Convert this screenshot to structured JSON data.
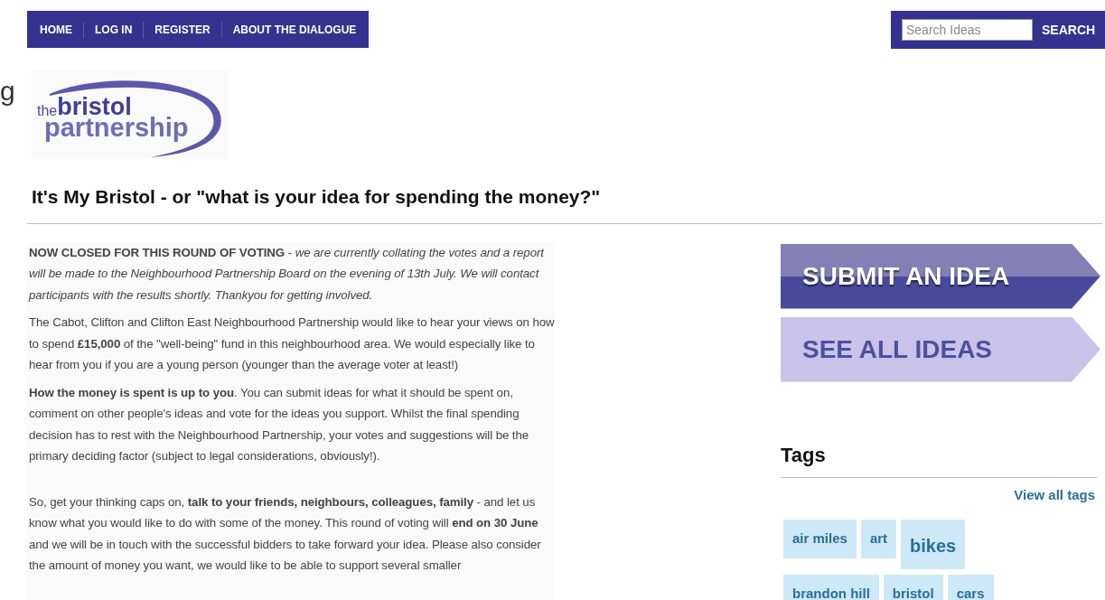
{
  "nav": {
    "items": [
      "HOME",
      "LOG IN",
      "REGISTER",
      "ABOUT THE DIALOGUE"
    ]
  },
  "search": {
    "placeholder": "Search Ideas",
    "button": "SEARCH"
  },
  "edge_text": "g",
  "logo": {
    "prefix": "the",
    "name": "bristol",
    "suffix": "partnership"
  },
  "heading": "It's My Bristol - or \"what is your idea for spending the money?\"",
  "paragraphs": [
    "**NOW CLOSED FOR THIS ROUND OF VOTING** - *we are currently collating the votes and a report will be made to the Neighbourhood Partnership Board on the evening of 13th July. We will contact participants with the results shortly. Thankyou for getting involved.*",
    "The Cabot, Clifton and Clifton East Neighbourhood Partnership would like to hear your views on how to spend **£15,000** of the \"well-being\" fund in this neighbourhood area. We would especially like to hear from you if you are a young person (younger than the average voter at least!)",
    "**How the money is spent is up to you**. You can submit ideas for what it should be spent on, comment on other people's ideas and vote for the ideas you support. Whilst the final spending decision has to rest with the Neighbourhood Partnership, your votes and suggestions will be the primary deciding factor (subject to legal considerations, obviously!).",
    "So, get your thinking caps on, **talk to your friends, neighbours, colleagues, family** - and let us know what you would like to do with some of the money. This round of voting will **end on 30 June** and we will be in touch with the successful bidders to take forward your idea. Please also consider the amount of money you want, we would like to be able to support several smaller"
  ],
  "actions": [
    {
      "label": "SUBMIT AN IDEA",
      "kind": "primary"
    },
    {
      "label": "SEE ALL IDEAS",
      "kind": "secondary"
    }
  ],
  "tags": {
    "title": "Tags",
    "view_all": "View all tags",
    "rows": [
      [
        {
          "label": "air miles",
          "kind": "normal"
        },
        {
          "label": "art",
          "kind": "normal"
        },
        {
          "label": "bikes",
          "kind": "large"
        }
      ],
      [
        {
          "label": "brandon hill",
          "kind": "normal"
        },
        {
          "label": "bristol",
          "kind": "normal"
        },
        {
          "label": "cars",
          "kind": "normal"
        }
      ]
    ]
  }
}
